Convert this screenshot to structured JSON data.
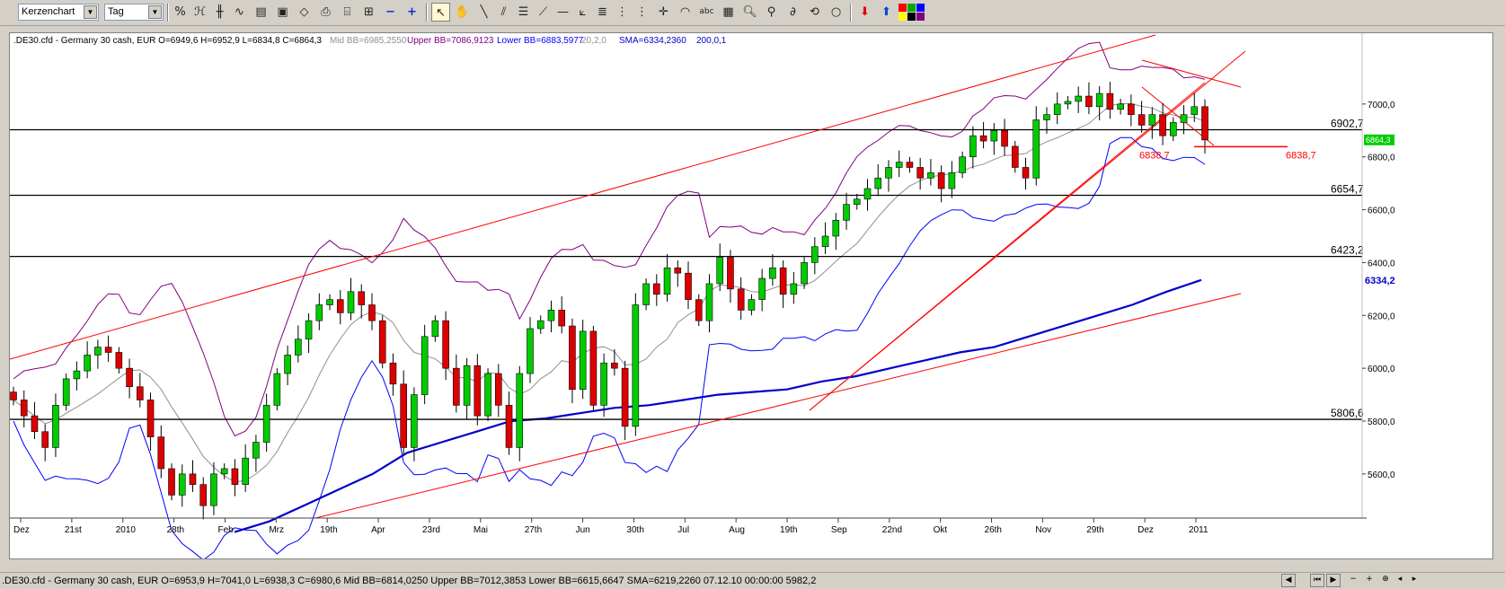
{
  "toolbar": {
    "chart_type": "Kerzenchart",
    "period": "Tag",
    "tools": [
      "cursor-icon",
      "hand-icon",
      "line-icon",
      "parallel-lines-icon",
      "horizontal-line-icon",
      "fan-icon",
      "fibonacci-icon",
      "grid-icon",
      "crosshair-icon",
      "arc-icon",
      "text-icon",
      "calculator-icon",
      "zoom-in-icon",
      "zoom-out-icon",
      "spiral-icon",
      "circle-icon",
      "arrow-down-icon",
      "arrow-up-icon",
      "color-palette-icon"
    ]
  },
  "header": {
    "symbol_info": ".DE30.cfd - Germany 30 cash, EUR O=6949,6 H=6952,9 L=6834,8 C=6864,3",
    "mid_bb": "Mid BB=6985,2550",
    "upper_bb": "Upper BB=7086,9123",
    "lower_bb": "Lower BB=6883,5977",
    "bb_params": "20,2,0",
    "sma": "SMA=6334,2360",
    "sma_params": "200,0,1"
  },
  "status": {
    "text": ".DE30.cfd - Germany 30 cash, EUR O=6953,9 H=7041,0 L=6938,3 C=6980,6  Mid BB=6814,0250 Upper BB=7012,3853 Lower BB=6615,6647 SMA=6219,2260  07.12.10 00:00:00 5982,2"
  },
  "colors": {
    "up_candle": "#00cc00",
    "down_candle": "#dd0000",
    "upper_bb": "#800080",
    "lower_bb": "#0000ff",
    "mid_bb": "#909090",
    "sma": "#0000cc",
    "trendline": "#ff0000"
  },
  "chart_data": {
    "type": "candlestick",
    "ylim": [
      5450,
      7200
    ],
    "y_ticks": [
      "7000,0",
      "6800,0",
      "6600,0",
      "6400,0",
      "6200,0",
      "6000,0",
      "5800,0",
      "5600,0"
    ],
    "x_ticks": [
      "Dez",
      "21st",
      "2010",
      "28th",
      "Feb",
      "Mrz",
      "19th",
      "Apr",
      "23rd",
      "Mai",
      "27th",
      "Jun",
      "30th",
      "Jul",
      "Aug",
      "19th",
      "Sep",
      "22nd",
      "Okt",
      "26th",
      "Nov",
      "29th",
      "Dez",
      "2011"
    ],
    "horizontal_levels": [
      {
        "label": "6902,7",
        "value": 6902.7
      },
      {
        "label": "6654,7",
        "value": 6654.7
      },
      {
        "label": "6423,2",
        "value": 6423.2
      },
      {
        "label": "5806,6",
        "value": 5806.6
      }
    ],
    "support_line": {
      "label_left": "6838,7",
      "label_right": "6838,7",
      "value": 6838.7
    },
    "current_price": {
      "label": "6864,3",
      "value": 6864.3
    },
    "sma_last": {
      "label": "6334,2",
      "value": 6334.2
    },
    "closes": [
      5880,
      5820,
      5760,
      5700,
      5860,
      5960,
      5990,
      6050,
      6080,
      6060,
      6000,
      5930,
      5880,
      5740,
      5620,
      5520,
      5600,
      5560,
      5480,
      5600,
      5620,
      5560,
      5660,
      5720,
      5860,
      5980,
      6050,
      6110,
      6180,
      6240,
      6260,
      6210,
      6290,
      6240,
      6180,
      6020,
      5940,
      5700,
      5900,
      6120,
      6180,
      6000,
      5860,
      6010,
      5820,
      5980,
      5860,
      5700,
      5980,
      6150,
      6180,
      6220,
      6160,
      5920,
      6140,
      5860,
      6020,
      6000,
      5780,
      6240,
      6320,
      6280,
      6380,
      6360,
      6260,
      6180,
      6320,
      6420,
      6300,
      6220,
      6260,
      6340,
      6380,
      6280,
      6320,
      6400,
      6460,
      6500,
      6560,
      6620,
      6640,
      6680,
      6720,
      6760,
      6780,
      6760,
      6720,
      6740,
      6680,
      6740,
      6800,
      6880,
      6860,
      6900,
      6840,
      6760,
      6720,
      6940,
      6960,
      7000,
      7010,
      7030,
      6990,
      7040,
      6980,
      7000,
      6960,
      6920,
      6960,
      6880,
      6930,
      6960,
      6990,
      6864.3
    ],
    "sma200": [
      5380,
      5420,
      5480,
      5540,
      5600,
      5680,
      5720,
      5760,
      5800,
      5810,
      5830,
      5850,
      5860,
      5880,
      5900,
      5910,
      5920,
      5950,
      5970,
      6000,
      6030,
      6060,
      6080,
      6120,
      6160,
      6200,
      6240,
      6290,
      6334.2
    ]
  }
}
